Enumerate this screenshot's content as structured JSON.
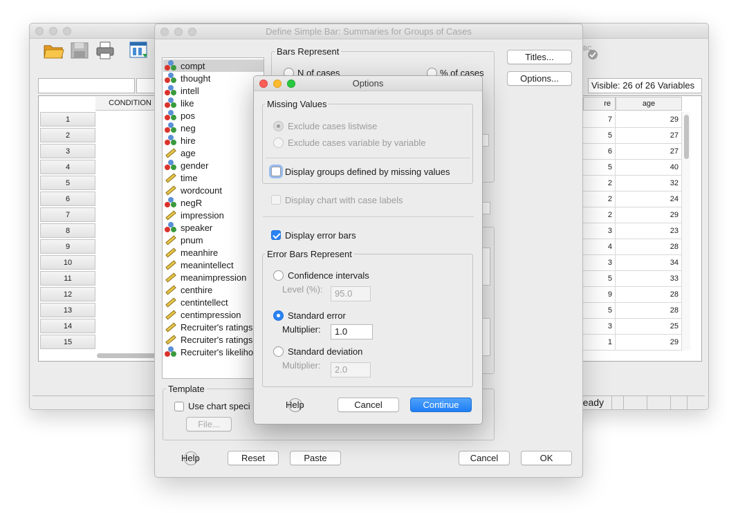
{
  "back_window": {
    "visible_label": "Visible: 26 of 26 Variables",
    "condition_header": "CONDITION",
    "col_hire_partial": "re",
    "col_age": "age",
    "rows": [
      "1",
      "2",
      "3",
      "4",
      "5",
      "6",
      "7",
      "8",
      "9",
      "10",
      "11",
      "12",
      "13",
      "14",
      "15"
    ],
    "hire_values": [
      "7",
      "5",
      "6",
      "5",
      "2",
      "2",
      "2",
      "3",
      "4",
      "3",
      "5",
      "9",
      "5",
      "3",
      "1"
    ],
    "age_values": [
      "29",
      "27",
      "27",
      "40",
      "32",
      "24",
      "29",
      "23",
      "28",
      "34",
      "33",
      "28",
      "28",
      "25",
      "29"
    ],
    "status_text": "ready",
    "toolbar": {
      "open_icon": "folder-open-icon",
      "save_icon": "floppy-disk-icon",
      "print_icon": "printer-icon",
      "variables_icon": "variables-view-icon"
    }
  },
  "define_dialog": {
    "title": "Define Simple Bar: Summaries for Groups of Cases",
    "variables": [
      {
        "name": "compt",
        "type": "nominal"
      },
      {
        "name": "thought",
        "type": "nominal"
      },
      {
        "name": "intell",
        "type": "nominal"
      },
      {
        "name": "like",
        "type": "nominal"
      },
      {
        "name": "pos",
        "type": "nominal"
      },
      {
        "name": "neg",
        "type": "nominal"
      },
      {
        "name": "hire",
        "type": "nominal"
      },
      {
        "name": "age",
        "type": "scale"
      },
      {
        "name": "gender",
        "type": "nominal"
      },
      {
        "name": "time",
        "type": "scale"
      },
      {
        "name": "wordcount",
        "type": "scale"
      },
      {
        "name": "negR",
        "type": "nominal"
      },
      {
        "name": "impression",
        "type": "scale"
      },
      {
        "name": "speaker",
        "type": "nominal"
      },
      {
        "name": "pnum",
        "type": "scale"
      },
      {
        "name": "meanhire",
        "type": "scale"
      },
      {
        "name": "meanintellect",
        "type": "scale"
      },
      {
        "name": "meanimpression",
        "type": "scale"
      },
      {
        "name": "centhire",
        "type": "scale"
      },
      {
        "name": "centintellect",
        "type": "scale"
      },
      {
        "name": "centimpression",
        "type": "scale"
      },
      {
        "name": "Recruiter's ratings.",
        "type": "scale"
      },
      {
        "name": "Recruiter's ratings.",
        "type": "scale"
      },
      {
        "name": "Recruiter's likeliho.",
        "type": "nominal"
      }
    ],
    "bars_represent_title": "Bars Represent",
    "n_of_cases": "N of cases",
    "pct_of_cases": "% of cases",
    "titles_button": "Titles...",
    "options_button": "Options...",
    "template_title": "Template",
    "use_chart_spec": "Use chart speci",
    "file_button": "File...",
    "help_button": "Help",
    "reset_button": "Reset",
    "paste_button": "Paste",
    "cancel_button": "Cancel",
    "ok_button": "OK"
  },
  "options_dialog": {
    "title": "Options",
    "missing_values_title": "Missing Values",
    "exclude_listwise": "Exclude cases listwise",
    "exclude_variable": "Exclude cases variable by variable",
    "display_groups_missing": "Display groups defined by missing values",
    "display_case_labels": "Display chart with case labels",
    "display_error_bars": "Display error bars",
    "error_bars_title": "Error Bars Represent",
    "confidence_intervals": "Confidence intervals",
    "level_label": "Level (%):",
    "level_value": "95.0",
    "standard_error": "Standard error",
    "multiplier_label": "Multiplier:",
    "se_multiplier_value": "1.0",
    "standard_deviation": "Standard deviation",
    "sd_multiplier_value": "2.0",
    "help_button": "Help",
    "cancel_button": "Cancel",
    "continue_button": "Continue"
  },
  "colors": {
    "accent": "#2a83f6",
    "nominal_blue": "#5b8fd6",
    "nominal_red": "#d9342b",
    "nominal_green": "#3a9a3d",
    "scale_yellow": "#e9c74a"
  }
}
